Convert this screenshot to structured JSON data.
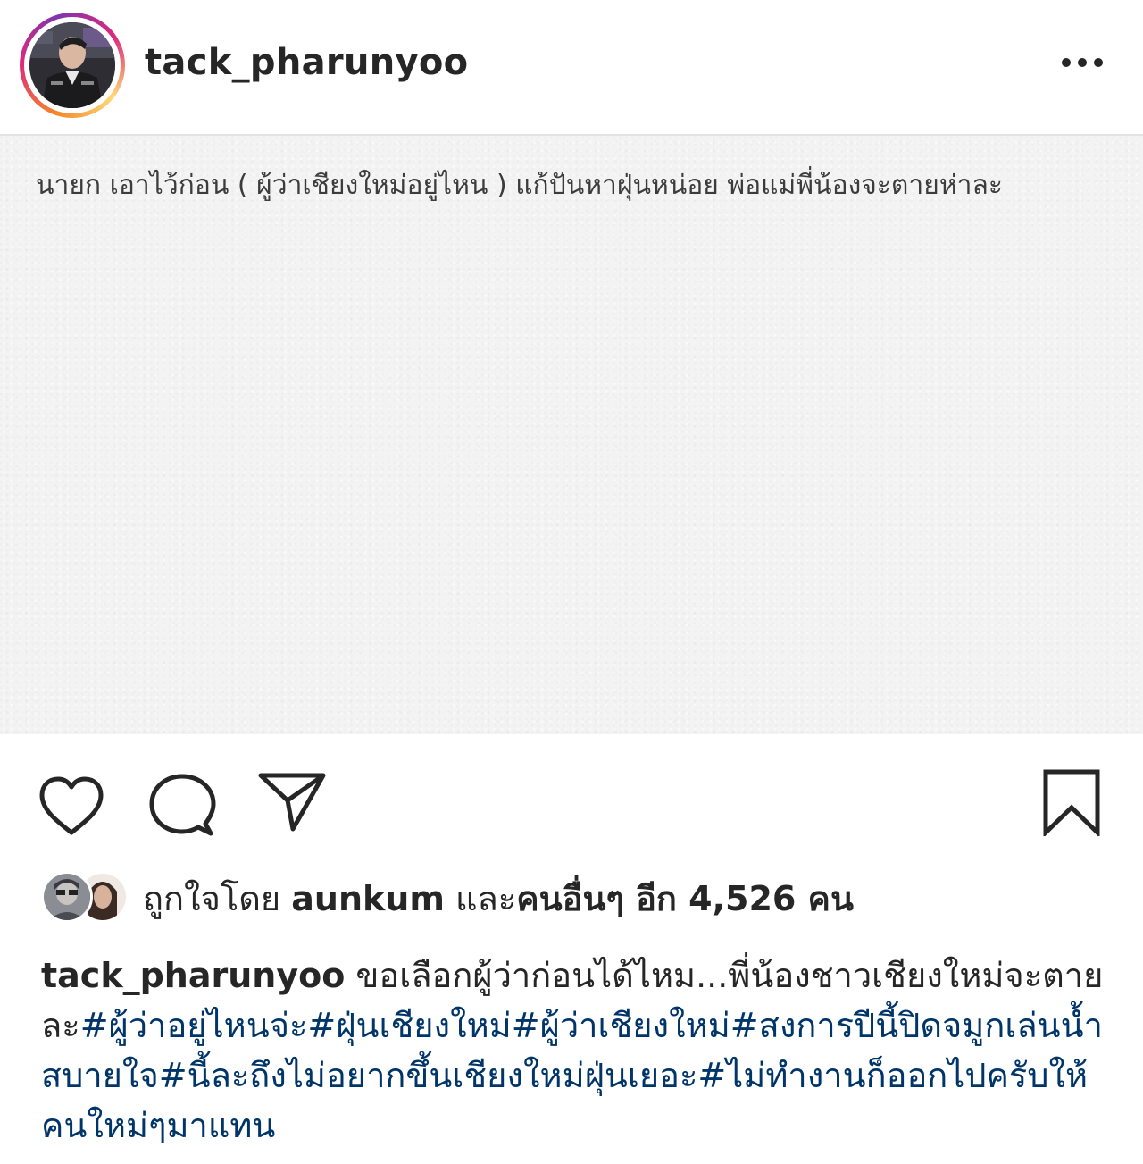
{
  "post": {
    "username": "tack_pharunyoo",
    "menu_icon": "more-horizontal-icon",
    "image_text": "นายก เอาไว้ก่อน ( ผู้ว่าเชียงใหม่อยู่ไหน ) แก้ปันหาฝุ่นหน่อย พ่อแม่พี่น้องจะตายห่าละ"
  },
  "actions": {
    "like_icon": "heart-icon",
    "comment_icon": "comment-icon",
    "share_icon": "paper-plane-icon",
    "save_icon": "bookmark-icon"
  },
  "likes": {
    "prefix": "ถูกใจโดย ",
    "user": "aunkum",
    "middle": " และ",
    "others": "คนอื่นๆ อีก 4,526 คน"
  },
  "caption": {
    "username": "tack_pharunyoo",
    "text": " ขอเลือกผู้ว่าก่อนได้ไหม...พี่น้องชาวเชียงใหม่จะตายละ",
    "hashtags": [
      "#ผู้ว่าอยู่ไหนจ่ะ",
      "#ฝุ่นเชียงใหม่",
      "#ผู้ว่าเชียงใหม่",
      "#สงการปีนี้ปิดจมูกเล่นน้ำสบายใจ",
      "#นี้ละถึงไม่อยากขึ้นเชียงใหม่ฝุ่นเยอะ",
      "#ไม่ทำงานก็ออกไปครับให้คนใหม่ๆมาแทน"
    ]
  },
  "colors": {
    "text": "#262626",
    "hashtag": "#003569",
    "image_bg": "#f3f3f3",
    "ring_start": "#f58529",
    "ring_end": "#8134af"
  }
}
